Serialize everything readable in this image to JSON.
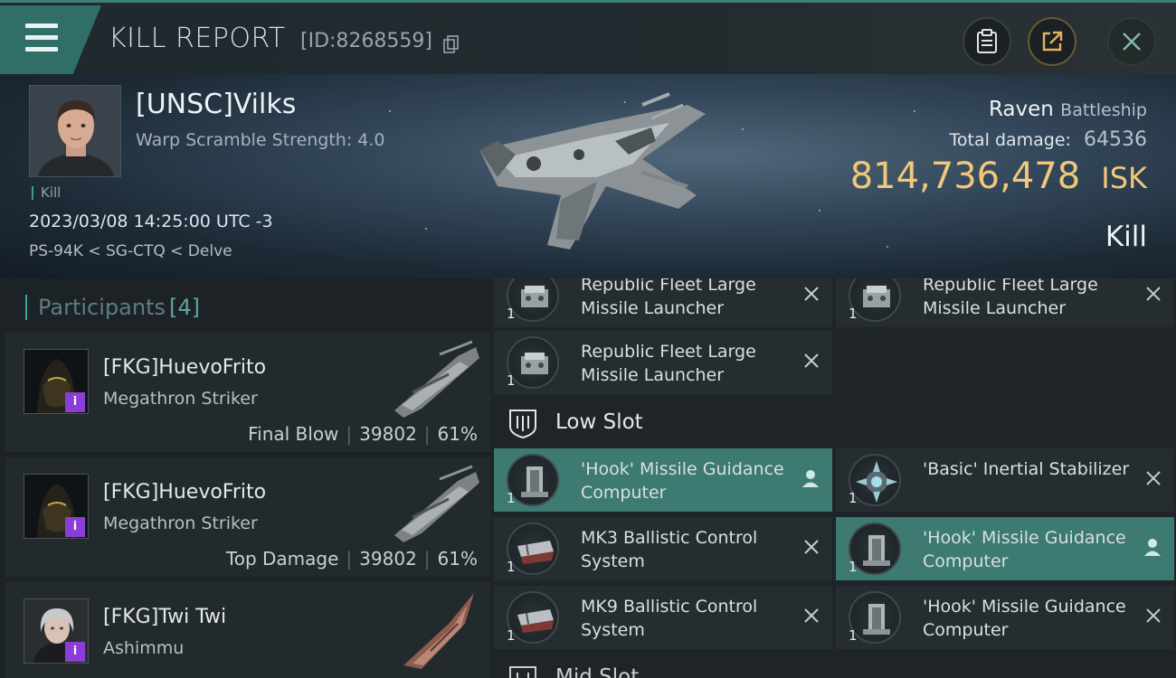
{
  "header": {
    "title": "KILL REPORT",
    "report_id": "[ID:8268559]"
  },
  "victim": {
    "name": "[UNSC]Vilks",
    "warp_scramble": "Warp Scramble Strength: 4.0",
    "kill_tag": "Kill",
    "datetime": "2023/03/08 14:25:00 UTC -3",
    "location": "PS-94K < SG-CTQ < Delve",
    "ship_name": "Raven",
    "ship_class": "Battleship",
    "total_damage_label": "Total damage:",
    "total_damage": "64536",
    "isk_value": "814,736,478",
    "isk_unit": "ISK",
    "result": "Kill"
  },
  "participants": {
    "label": "Participants",
    "count": "[4]",
    "list": [
      {
        "name": "[FKG]HuevoFrito",
        "ship": "Megathron Striker",
        "role": "Final Blow",
        "damage": "39802",
        "percent": "61%"
      },
      {
        "name": "[FKG]HuevoFrito",
        "ship": "Megathron Striker",
        "role": "Top Damage",
        "damage": "39802",
        "percent": "61%"
      },
      {
        "name": "[FKG]Twi Twi",
        "ship": "Ashimmu",
        "role": "",
        "damage": "",
        "percent": ""
      }
    ]
  },
  "modules": {
    "high_slot": [
      {
        "qty": "1",
        "name": "Republic Fleet Large Missile Launcher"
      },
      {
        "qty": "1",
        "name": "Republic Fleet Large Missile Launcher"
      },
      {
        "qty": "1",
        "name": "Republic Fleet Large Missile Launcher"
      }
    ],
    "low_slot_label": "Low Slot",
    "low_slot": [
      {
        "qty": "1",
        "name": "'Hook' Missile Guidance Computer"
      },
      {
        "qty": "1",
        "name": "'Basic' Inertial Stabilizer"
      },
      {
        "qty": "1",
        "name": "MK3 Ballistic Control System"
      },
      {
        "qty": "1",
        "name": "'Hook' Missile Guidance Computer"
      },
      {
        "qty": "1",
        "name": "MK9 Ballistic Control System"
      },
      {
        "qty": "1",
        "name": "'Hook' Missile Guidance Computer"
      }
    ],
    "mid_slot_label": "Mid Slot"
  },
  "colors": {
    "accent": "#3c7a72",
    "isk": "#f1c77a",
    "badge": "#8a3ed6"
  }
}
